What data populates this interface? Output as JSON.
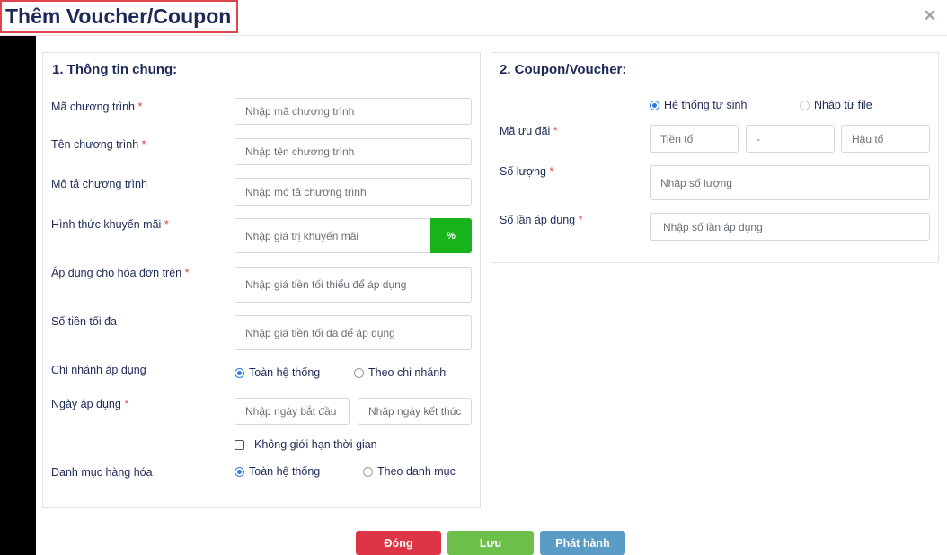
{
  "header": {
    "title": "Thêm Voucher/Coupon",
    "close_icon": "close-icon"
  },
  "general": {
    "section_title": "1. Thông tin chung:",
    "program_code": {
      "label": "Mã chương trình",
      "placeholder": "Nhập mã chương trình",
      "required_mark": "*"
    },
    "program_name": {
      "label": "Tên chương trình",
      "placeholder": "Nhập tên chương trình",
      "required_mark": "*"
    },
    "program_desc": {
      "label": "Mô tả chương trình",
      "placeholder": "Nhập mô tả chương trình"
    },
    "promo_type": {
      "label": "Hình thức khuyến mãi",
      "placeholder": "Nhập giá trị khuyến mãi",
      "required_mark": "*",
      "unit": "%"
    },
    "min_invoice": {
      "label": "Áp dụng cho hóa đơn trên",
      "placeholder": "Nhập giá tiền tối thiểu để áp dụng",
      "required_mark": "*"
    },
    "max_amount": {
      "label": "Số tiền tối đa",
      "placeholder": "Nhập giá tiền tối đa để áp dụng"
    },
    "branch": {
      "label": "Chi nhánh áp dụng",
      "option_all": "Toàn hệ thống",
      "option_branch": "Theo chi nhánh",
      "selected": "all"
    },
    "apply_date": {
      "label": "Ngày áp dụng",
      "required_mark": "*",
      "start_placeholder": "Nhập ngày bắt đầu",
      "end_placeholder": "Nhập ngày kết thúc"
    },
    "no_time_limit": {
      "label": "Không giới hạn thời gian",
      "checked": false
    },
    "category": {
      "label": "Danh mục hàng hóa",
      "option_all": "Toàn hệ thống",
      "option_category": "Theo danh mục",
      "selected": "all"
    }
  },
  "coupon": {
    "section_title": "2. Coupon/Voucher:",
    "source": {
      "option_auto": "Hệ thống tự sinh",
      "option_file": "Nhập từ file",
      "selected": "auto"
    },
    "code": {
      "label": "Mã ưu đãi",
      "required_mark": "*",
      "prefix_placeholder": "Tiền tố",
      "middle_placeholder": "-",
      "suffix_placeholder": "Hậu tố"
    },
    "quantity": {
      "label": "Số lượng",
      "required_mark": "*",
      "placeholder": "Nhập số lượng"
    },
    "uses": {
      "label": "Số lần áp dụng",
      "required_mark": "*",
      "placeholder": "Nhập số lần áp dụng"
    }
  },
  "footer": {
    "close_label": "Đóng",
    "save_label": "Lưu",
    "publish_label": "Phát hành"
  },
  "colors": {
    "danger": "#dc3545",
    "success": "#6cc04a",
    "info": "#5b9cc7",
    "percent_green": "#17b31a",
    "title_navy": "#1d2a57",
    "highlight_red": "#e0454b"
  }
}
